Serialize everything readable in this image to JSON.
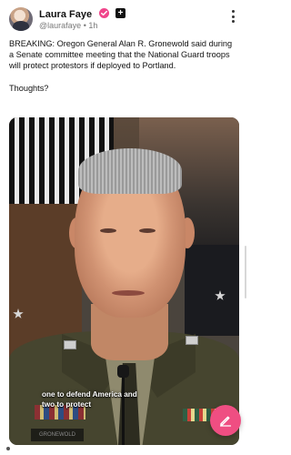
{
  "post": {
    "author": {
      "name": "Laura Faye",
      "handle": "@laurafaye",
      "time": "1h",
      "separator": "•"
    },
    "badges": {
      "verified_icon": "pink-check-badge-icon",
      "plus_icon": "plus-badge-icon",
      "plus_text": "+"
    },
    "text": [
      "BREAKING: Oregon General Alan R. Gronewold said during a Senate committee meeting that the National Guard troops will protect protestors if deployed to Portland.",
      "Thoughts?"
    ],
    "media": {
      "caption_lines": [
        "one to defend America and",
        "two to protect"
      ],
      "nameplate": "GRONEWOLD"
    }
  },
  "actions": {
    "more_icon": "vertical-ellipsis-icon",
    "compose_icon": "pencil-icon"
  },
  "colors": {
    "accent": "#ef4e82",
    "verified": "#f0458b",
    "text": "#111111",
    "muted": "#7a7a7a"
  }
}
